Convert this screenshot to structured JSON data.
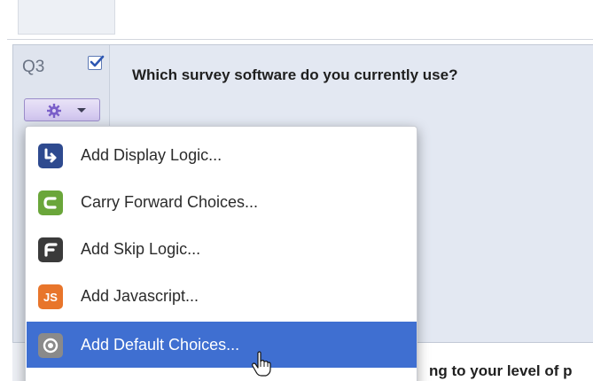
{
  "question": {
    "number": "Q3",
    "checked": true,
    "text": "Which survey software do you currently use?"
  },
  "next_question": {
    "partial_text": "ng to your level of p"
  },
  "menu": {
    "items": [
      {
        "label": "Add Display Logic...",
        "icon": "display-logic-icon",
        "color": "#2e4a8f"
      },
      {
        "label": "Carry Forward Choices...",
        "icon": "carry-forward-icon",
        "color": "#6aa63a"
      },
      {
        "label": "Add Skip Logic...",
        "icon": "skip-logic-icon",
        "color": "#3a3a3a"
      },
      {
        "label": "Add Javascript...",
        "icon": "javascript-icon",
        "color": "#e8752b"
      },
      {
        "label": "Add Default Choices...",
        "icon": "default-choices-icon",
        "color": "#8a8a8a",
        "highlighted": true
      }
    ]
  },
  "colors": {
    "highlight": "#3f6fd1",
    "question_bg": "#e3e8f2",
    "gear_button": "#cfc3ee"
  }
}
